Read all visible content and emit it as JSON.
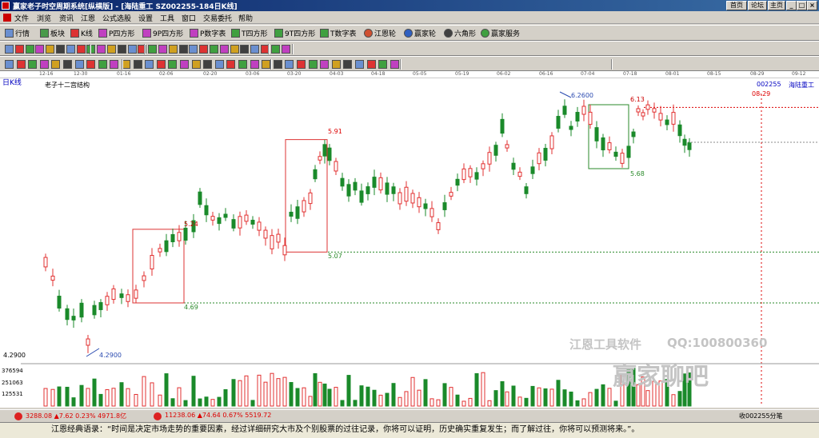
{
  "window": {
    "title": "赢家老子时空周期系统[纵横版] - [海陆重工  SZ002255-184日K线]",
    "right_links": [
      "首页",
      "论坛",
      "主页"
    ],
    "controls": [
      "_",
      "□",
      "×"
    ]
  },
  "menu": [
    "文件",
    "浏览",
    "资讯",
    "江恩",
    "公式选股",
    "设置",
    "工具",
    "窗口",
    "交易委托",
    "帮助"
  ],
  "toolbar1": [
    {
      "label": "行情",
      "icon": "quote-icon"
    },
    {
      "label": "板块",
      "icon": "sector-icon"
    },
    {
      "label": "K线",
      "icon": "kline-icon"
    },
    {
      "label": "P四方形",
      "icon": "p-square-icon"
    },
    {
      "label": "9P四方形",
      "icon": "9p-square-icon"
    },
    {
      "label": "P数字表",
      "icon": "p-number-table-icon"
    },
    {
      "label": "T四方形",
      "icon": "t-square-icon"
    },
    {
      "label": "9T四方形",
      "icon": "9t-square-icon"
    },
    {
      "label": "T数字表",
      "icon": "t-number-table-icon"
    },
    {
      "label": "江恩轮",
      "icon": "gann-wheel-icon"
    },
    {
      "label": "赢家轮",
      "icon": "winner-wheel-icon"
    },
    {
      "label": "六角形",
      "icon": "hexagon-icon"
    },
    {
      "label": "赢家服务",
      "icon": "service-icon"
    }
  ],
  "dates": [
    "12-16",
    "12-30",
    "01-16",
    "02-06",
    "02-20",
    "03-06",
    "03-20",
    "04-03",
    "04-18",
    "05-05",
    "05-19",
    "06-02",
    "06-16",
    "07-04",
    "07-18",
    "08-01",
    "08-15",
    "08-29",
    "09-12"
  ],
  "chart": {
    "period": "日K线",
    "indicator": "老子十二宫结构",
    "code": "002255",
    "name": "海陆重工",
    "date_marker": "08-29",
    "price_labels": [
      "5.91",
      "5.24",
      "5.07",
      "4.69",
      "4.2900",
      "6.2600",
      "6.13",
      "5.68"
    ],
    "axis_price": "4.2900",
    "volume_ticks": [
      "376594",
      "251063",
      "125531"
    ]
  },
  "watermark": {
    "software": "江恩工具软件",
    "qq": "QQ:100800360",
    "forum": "赢家聊吧"
  },
  "status": {
    "index1": "3288.08 ▲7.62 0.23% 4971.8亿",
    "index2": "11238.06 ▲74.64 0.67% 5519.72",
    "right": "收002255分笔"
  },
  "quote": "江恩经典语录：“时间是决定市场走势的重要因素，经过详细研究大市及个别股票的过往记录，你将可以证明，历史确实重复发生；而了解过往，你将可以预测将来。”。"
}
